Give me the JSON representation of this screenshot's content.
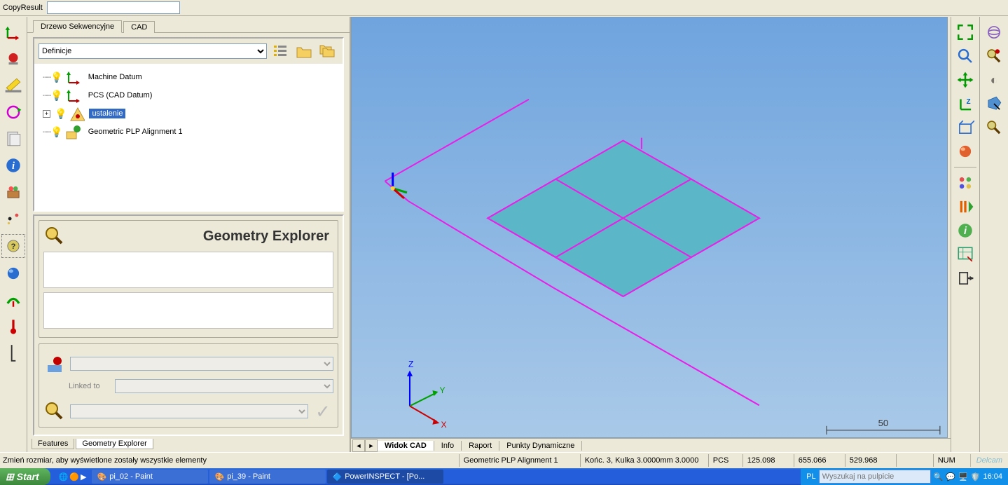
{
  "top": {
    "copy_label": "CopyResult"
  },
  "tabs": {
    "seq": "Drzewo Sekwencyjne",
    "cad": "CAD"
  },
  "definitions_label": "Definicje",
  "tree": {
    "items": [
      {
        "label": "Machine Datum"
      },
      {
        "label": "PCS (CAD Datum)"
      },
      {
        "label": "ustalenie"
      },
      {
        "label": "Geometric PLP Alignment 1"
      }
    ]
  },
  "geo": {
    "title": "Geometry Explorer",
    "linked_to": "Linked to"
  },
  "bottom_tabs": {
    "features": "Features",
    "geo": "Geometry Explorer"
  },
  "viewport_tabs": {
    "widok": "Widok CAD",
    "info": "Info",
    "raport": "Raport",
    "punkty": "Punkty Dynamiczne"
  },
  "scale_label": "50",
  "axes": {
    "x": "X",
    "y": "Y",
    "z": "Z"
  },
  "status": {
    "hint": "Zmień rozmiar, aby wyświetlone zostały wszystkie elementy",
    "align": "Geometric PLP Alignment 1",
    "probe": "Końc. 3, Kulka 3.0000mm 3.0000",
    "pcs": "PCS",
    "x": "125.098",
    "y": "655.066",
    "z": "529.968",
    "num": "NUM",
    "brand": "Delcam"
  },
  "taskbar": {
    "start": "Start",
    "t1": "pi_02 - Paint",
    "t2": "pi_39 - Paint",
    "t3": "PowerINSPECT  - [Po...",
    "lang": "PL",
    "search_placeholder": "Wyszukaj na pulpicie",
    "clock": "16:04"
  }
}
